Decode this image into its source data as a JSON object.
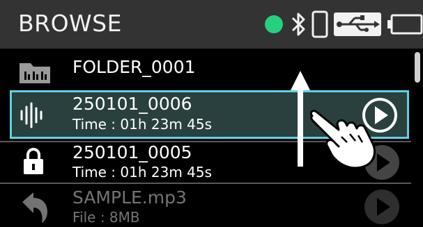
{
  "header": {
    "title": "BROWSE",
    "icons": [
      "status-dot-icon",
      "bluetooth-icon",
      "phone-icon",
      "usb-icon",
      "battery-icon"
    ],
    "status_color": "#25d17a"
  },
  "list": {
    "items": [
      {
        "icon": "folder-icon",
        "title": "FOLDER_0001",
        "subtitle": ""
      },
      {
        "icon": "waveform-icon",
        "title": "250101_0006",
        "subtitle": "Time : 01h 23m 45s",
        "selected": true
      },
      {
        "icon": "lock-icon",
        "title": "250101_0005",
        "subtitle": "Time : 01h 23m 45s"
      },
      {
        "icon": "undo-arrow-icon",
        "title": "SAMPLE.mp3",
        "subtitle": "File : 8MB"
      }
    ]
  },
  "colors": {
    "selection_border": "#5bd3e1",
    "selection_bg": "#29403f"
  },
  "gesture": {
    "type": "swipe-up",
    "icons": [
      "swipe-arrow-icon",
      "hand-pointer-icon"
    ]
  }
}
